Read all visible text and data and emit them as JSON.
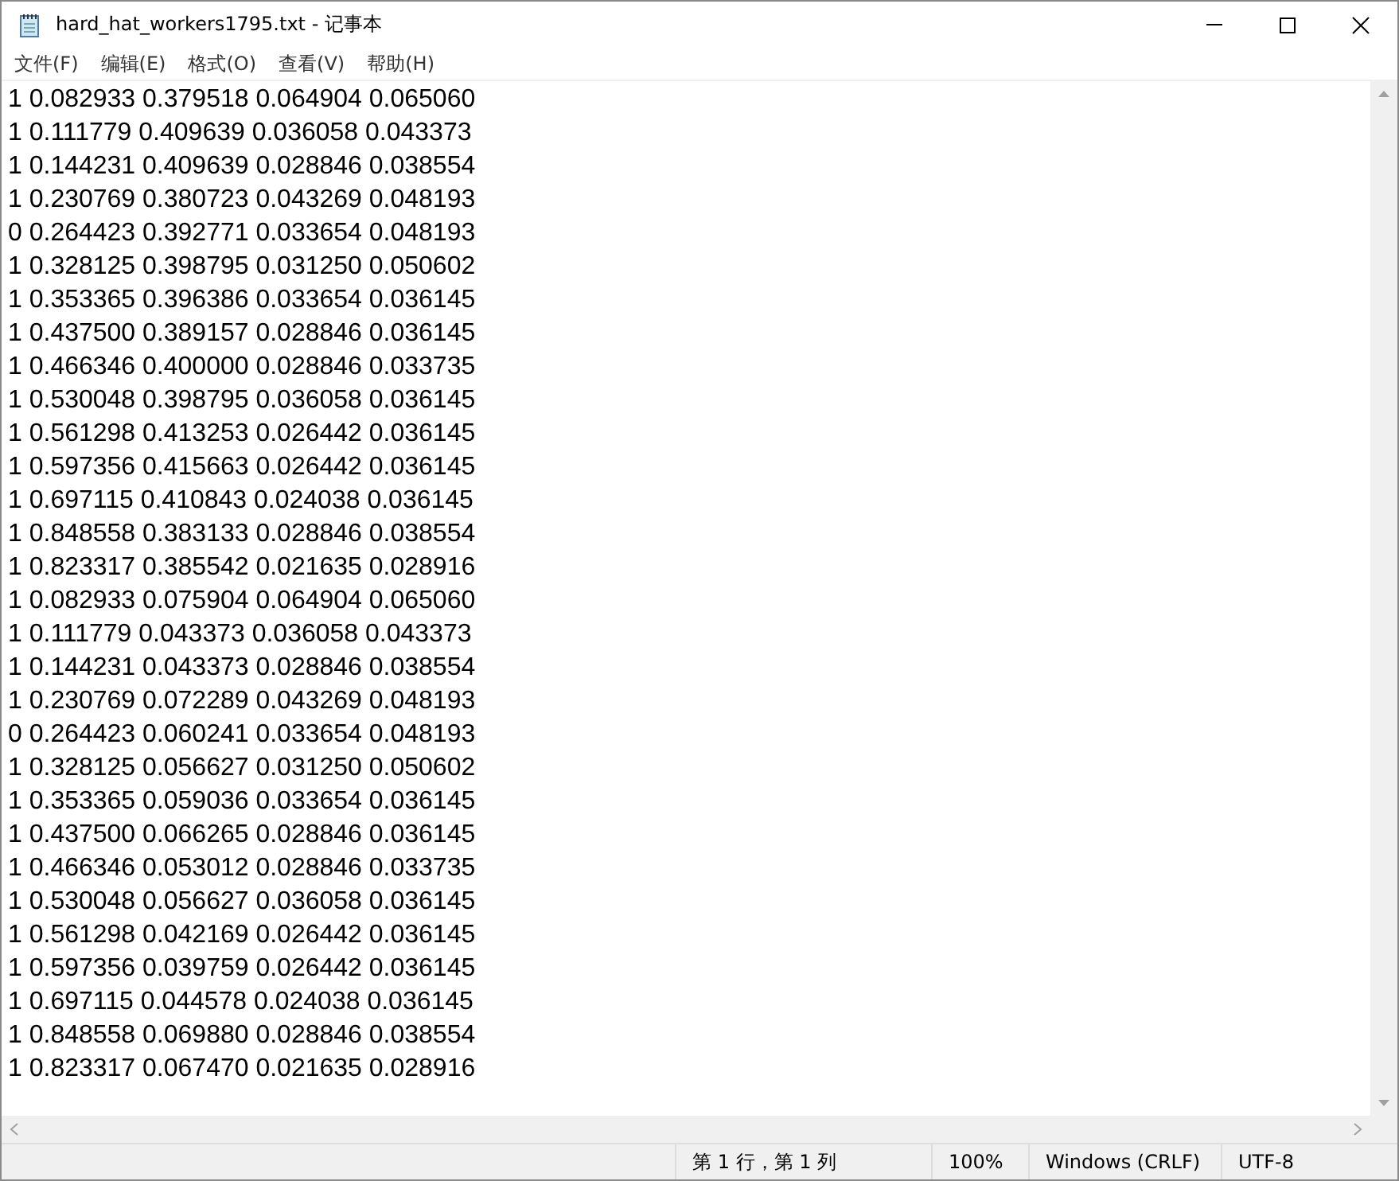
{
  "window": {
    "title": "hard_hat_workers1795.txt - 记事本"
  },
  "menu": [
    "文件(F)",
    "编辑(E)",
    "格式(O)",
    "查看(V)",
    "帮助(H)"
  ],
  "lines": [
    "1 0.082933 0.379518 0.064904 0.065060",
    "1 0.111779 0.409639 0.036058 0.043373",
    "1 0.144231 0.409639 0.028846 0.038554",
    "1 0.230769 0.380723 0.043269 0.048193",
    "0 0.264423 0.392771 0.033654 0.048193",
    "1 0.328125 0.398795 0.031250 0.050602",
    "1 0.353365 0.396386 0.033654 0.036145",
    "1 0.437500 0.389157 0.028846 0.036145",
    "1 0.466346 0.400000 0.028846 0.033735",
    "1 0.530048 0.398795 0.036058 0.036145",
    "1 0.561298 0.413253 0.026442 0.036145",
    "1 0.597356 0.415663 0.026442 0.036145",
    "1 0.697115 0.410843 0.024038 0.036145",
    "1 0.848558 0.383133 0.028846 0.038554",
    "1 0.823317 0.385542 0.021635 0.028916",
    "1 0.082933 0.075904 0.064904 0.065060",
    "1 0.111779 0.043373 0.036058 0.043373",
    "1 0.144231 0.043373 0.028846 0.038554",
    "1 0.230769 0.072289 0.043269 0.048193",
    "0 0.264423 0.060241 0.033654 0.048193",
    "1 0.328125 0.056627 0.031250 0.050602",
    "1 0.353365 0.059036 0.033654 0.036145",
    "1 0.437500 0.066265 0.028846 0.036145",
    "1 0.466346 0.053012 0.028846 0.033735",
    "1 0.530048 0.056627 0.036058 0.036145",
    "1 0.561298 0.042169 0.026442 0.036145",
    "1 0.597356 0.039759 0.026442 0.036145",
    "1 0.697115 0.044578 0.024038 0.036145",
    "1 0.848558 0.069880 0.028846 0.038554",
    "1 0.823317 0.067470 0.021635 0.028916"
  ],
  "status_bar": {
    "position": "第 1 行，第 1 列",
    "zoom": "100%",
    "line_ending": "Windows (CRLF)",
    "encoding": "UTF-8"
  }
}
